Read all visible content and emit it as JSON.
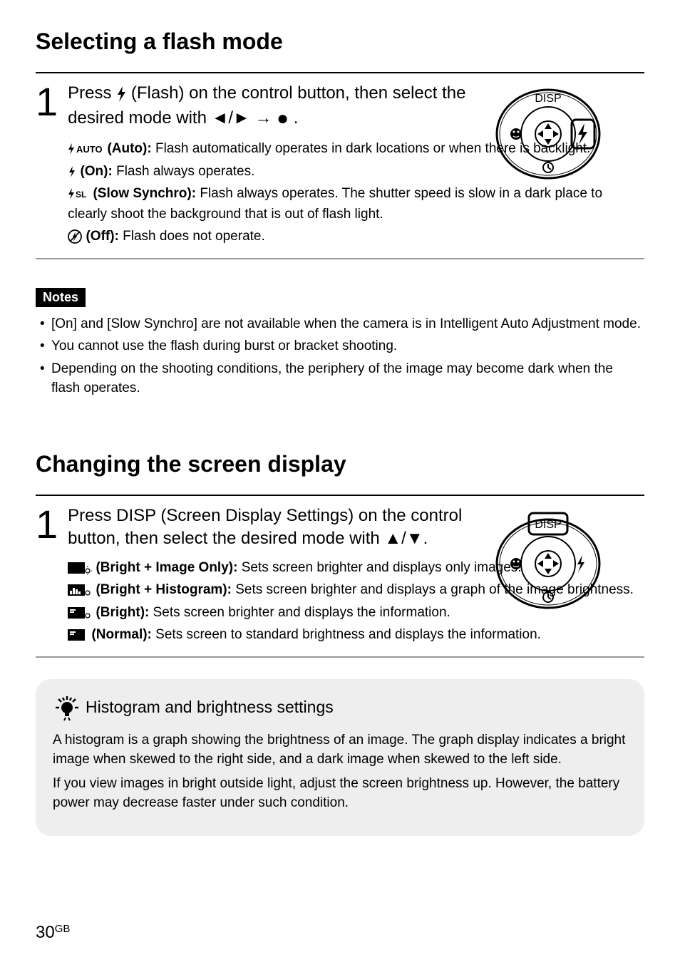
{
  "section1": {
    "title": "Selecting a flash mode",
    "step_num": "1",
    "instruction_part1": "Press ",
    "instruction_part2": " (Flash) on the control button, then select the desired mode with ",
    "instruction_arrows": "b/B",
    "instruction_suffix": ".",
    "options": {
      "auto": {
        "label": " (Auto):",
        "text": " Flash automatically operates in dark locations or when there is backlight."
      },
      "on": {
        "label": " (On):",
        "text": " Flash always operates."
      },
      "slow": {
        "label": " (Slow Synchro):",
        "text": " Flash always operates. The shutter speed is slow in a dark place to clearly shoot the background that is out of flash light."
      },
      "off": {
        "label": " (Off):",
        "text": " Flash does not operate."
      }
    }
  },
  "notes": {
    "label": "Notes",
    "items": [
      "[On] and [Slow Synchro] are not available when the camera is in Intelligent Auto Adjustment mode.",
      "You cannot use the flash during burst or bracket shooting.",
      "Depending on the shooting conditions, the periphery of the image may become dark when the flash operates."
    ]
  },
  "section2": {
    "title": "Changing the screen display",
    "step_num": "1",
    "instruction": "Press DISP (Screen Display Settings) on the control button, then select the desired mode with v/V.",
    "options": {
      "bio": {
        "label": " (Bright + Image Only):",
        "text": " Sets screen brighter and displays only images."
      },
      "bh": {
        "label": " (Bright + Histogram):",
        "text": " Sets screen brighter and displays a graph of the image brightness."
      },
      "b": {
        "label": " (Bright):",
        "text": " Sets screen brighter and displays the information."
      },
      "n": {
        "label": " (Normal):",
        "text": " Sets screen to standard brightness and displays the information."
      }
    }
  },
  "tip": {
    "title": "Histogram and brightness settings",
    "body1": "A histogram is a graph showing the brightness of an image. The graph display indicates a bright image when skewed to the right side, and a dark image when skewed to the left side.",
    "body2": "If you view images in bright outside light, adjust the screen brightness up. However, the battery power may decrease faster under such condition."
  },
  "page": {
    "num": "30",
    "suffix": "GB"
  },
  "pad": {
    "disp": "DISP"
  }
}
